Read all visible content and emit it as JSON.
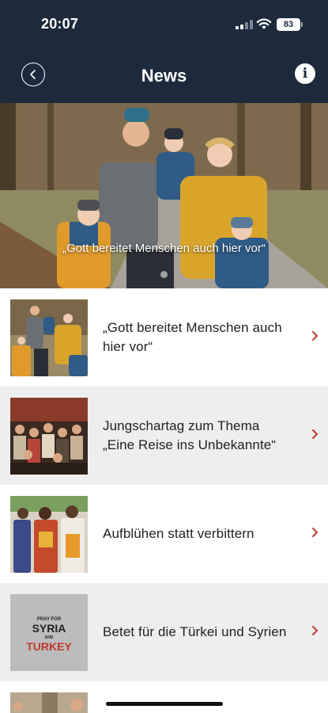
{
  "status_bar": {
    "time": "20:07",
    "battery": "83"
  },
  "nav": {
    "title": "News"
  },
  "hero": {
    "caption": "„Gott bereitet Menschen auch hier vor“",
    "slides": 3,
    "active": 1
  },
  "news": [
    {
      "title": "„Gott bereitet Menschen auch hier vor“"
    },
    {
      "title": "Jungschartag zum Thema „Eine Reise ins Unbekannte“"
    },
    {
      "title": "Aufblühen statt verbittern"
    },
    {
      "title": "Betet für die Türkei und Syrien"
    }
  ],
  "thumb4": {
    "line1": "PRAY FOR",
    "line2": "SYRIA",
    "line3": "AND",
    "line4": "TURKEY"
  },
  "colors": {
    "nav_bg": "#1d2a3b",
    "chevron": "#c0392b"
  }
}
